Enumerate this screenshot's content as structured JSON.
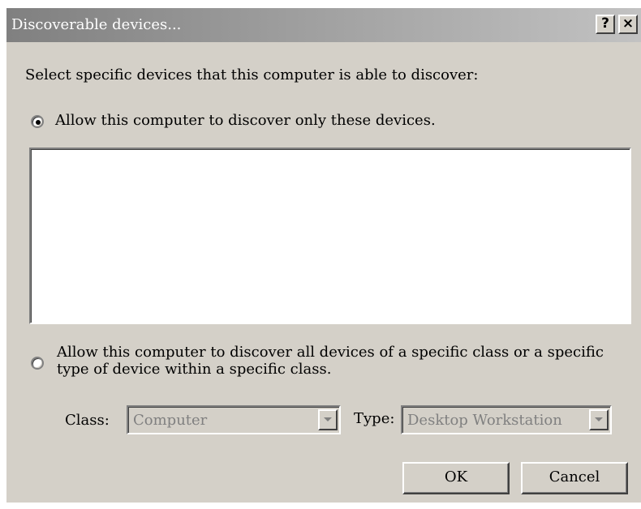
{
  "window": {
    "title": "Discoverable devices...",
    "help_label": "?",
    "close_label": "×"
  },
  "prompt": "Select specific devices that this computer is able to discover:",
  "option_specific": {
    "label": "Allow this computer to discover only these devices.",
    "selected": true
  },
  "device_list": {
    "items": []
  },
  "option_class": {
    "label_line1": "Allow this computer to discover all devices of a specific class or a specific",
    "label_line2": "type of device within a specific class.",
    "selected": false
  },
  "class_field": {
    "label": "Class:",
    "value": "Computer",
    "enabled": false
  },
  "type_field": {
    "label": "Type:",
    "value": "Desktop Workstation",
    "enabled": false
  },
  "buttons": {
    "ok": "OK",
    "cancel": "Cancel"
  }
}
